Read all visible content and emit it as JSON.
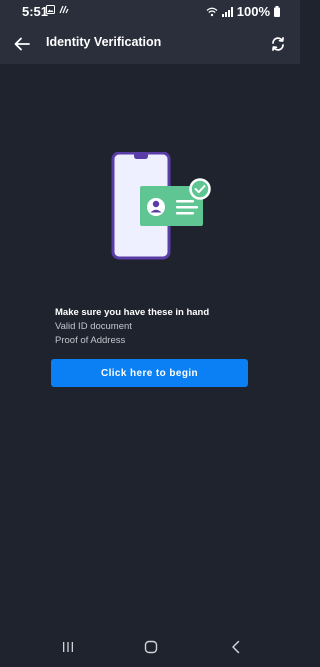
{
  "status_bar": {
    "time": "5:51",
    "battery": "100%",
    "icons": [
      "image-icon",
      "signal-activity-icon",
      "wifi-icon",
      "cellular-signal-icon",
      "battery-icon"
    ]
  },
  "app_bar": {
    "title": "Identity Verification",
    "back_icon": "arrow-left-icon",
    "refresh_icon": "refresh-icon"
  },
  "illustration": {
    "description_icon": "phone-id-verified-icon",
    "colors": {
      "phone_frame": "#5b3da8",
      "phone_screen": "#eef0ff",
      "card": "#5ec593",
      "check_badge": "#5ec593"
    }
  },
  "requirements": {
    "title": "Make sure you have these in hand",
    "items": [
      "Valid ID document",
      "Proof of Address"
    ]
  },
  "actions": {
    "begin_label": "Click here to begin",
    "accent": "#0b80f5"
  },
  "nav_bar": {
    "icons": [
      "recents-icon",
      "home-icon",
      "back-icon"
    ]
  }
}
